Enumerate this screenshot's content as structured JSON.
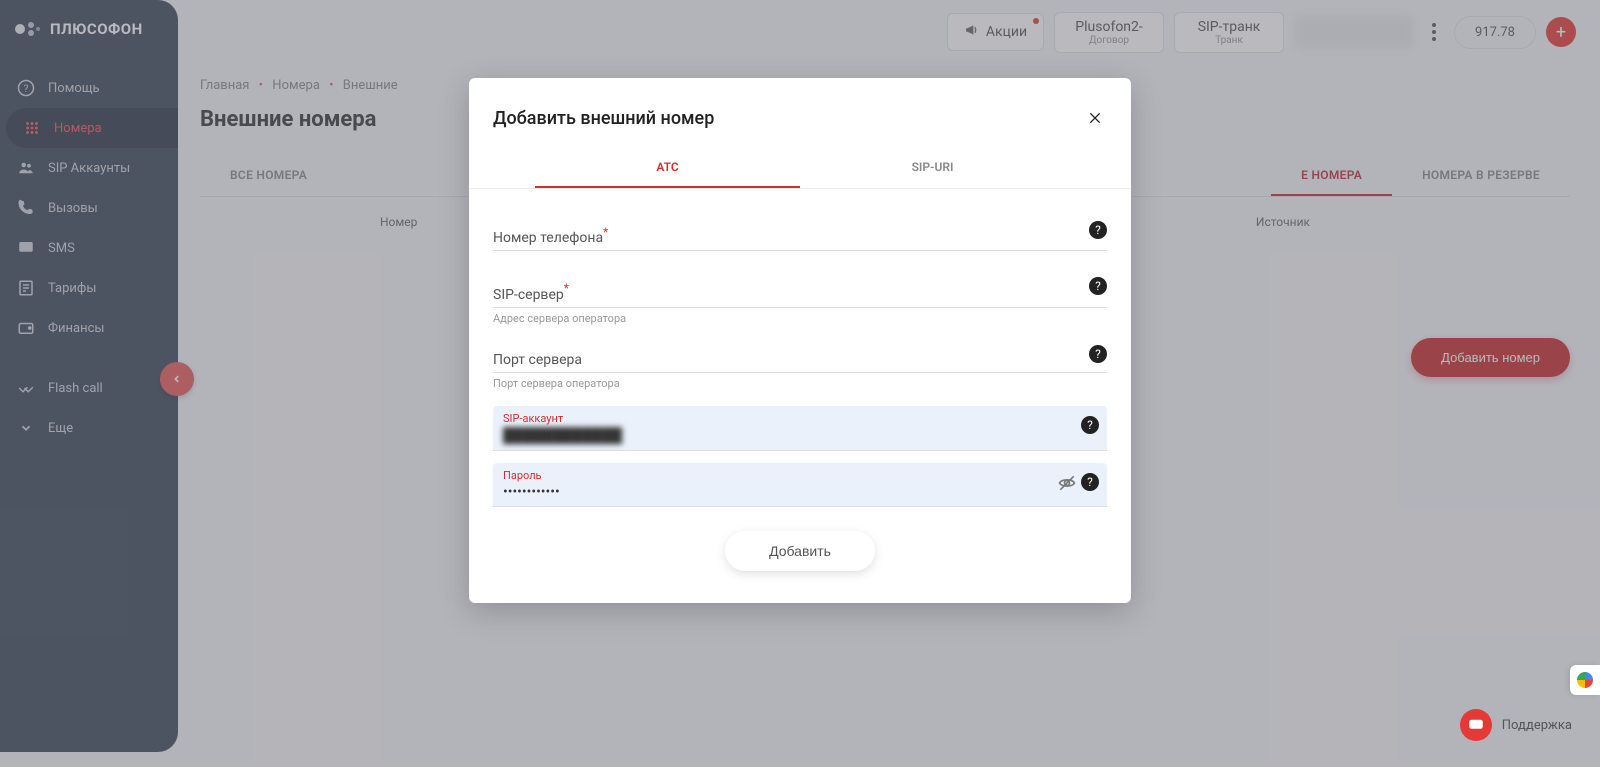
{
  "brand": "ПЛЮСОФОН",
  "sidebar": {
    "items": [
      {
        "label": "Помощь",
        "icon": "help"
      },
      {
        "label": "Номера",
        "icon": "dialpad",
        "active": true
      },
      {
        "label": "SIP Аккаунты",
        "icon": "people"
      },
      {
        "label": "Вызовы",
        "icon": "phone"
      },
      {
        "label": "SMS",
        "icon": "chat"
      },
      {
        "label": "Тарифы",
        "icon": "receipt"
      },
      {
        "label": "Финансы",
        "icon": "wallet"
      },
      {
        "label": "Flash call",
        "icon": "check"
      },
      {
        "label": "Еще",
        "icon": "expand"
      }
    ]
  },
  "header": {
    "promo": "Акции",
    "contract": {
      "title": "Plusofon2-",
      "sub": "Договор"
    },
    "trunk": {
      "title": "SIP-транк",
      "sub": "Транк"
    },
    "balance": "917.78"
  },
  "breadcrumb": {
    "home": "Главная",
    "numbers": "Номера",
    "external": "Внешние"
  },
  "page_title": "Внешние номера",
  "tabs": {
    "all": "ВСЕ НОМЕРА",
    "ext_active": "Е НОМЕРА",
    "reserve": "НОМЕРА В РЕЗЕРВЕ"
  },
  "table": {
    "col_number": "Номер",
    "col_source": "Источник"
  },
  "add_number_btn": "Добавить номер",
  "modal": {
    "title": "Добавить внешний номер",
    "tab_atc": "АТС",
    "tab_sip": "SIP-URI",
    "phone_label": "Номер телефона",
    "sip_server_label": "SIP-сервер",
    "sip_server_hint": "Адрес сервера оператора",
    "port_label": "Порт сервера",
    "port_hint": "Порт сервера оператора",
    "sip_account_label": "SIP-аккаунт",
    "sip_account_value": "████████████",
    "password_label": "Пароль",
    "password_value": "••••••••••••",
    "submit": "Добавить"
  },
  "support": "Поддержка"
}
